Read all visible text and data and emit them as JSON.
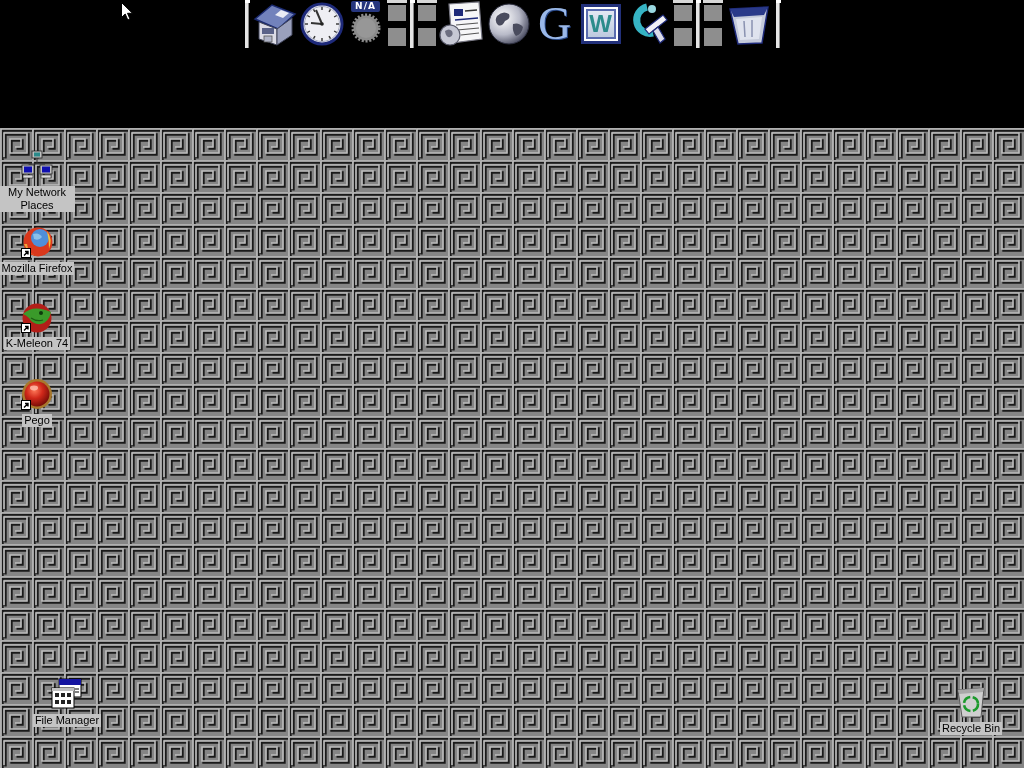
{
  "dock": {
    "items": [
      {
        "kind": "divider"
      },
      {
        "kind": "house"
      },
      {
        "kind": "clock"
      },
      {
        "kind": "weather",
        "label": "N/A"
      },
      {
        "kind": "tiles"
      },
      {
        "kind": "divider"
      },
      {
        "kind": "tiles"
      },
      {
        "kind": "document"
      },
      {
        "kind": "globe"
      },
      {
        "kind": "letter",
        "label": "G"
      },
      {
        "kind": "wordtile",
        "label": "W"
      },
      {
        "kind": "tool"
      },
      {
        "kind": "tiles"
      },
      {
        "kind": "divider"
      },
      {
        "kind": "tiles"
      },
      {
        "kind": "trash"
      },
      {
        "kind": "divider"
      }
    ]
  },
  "desktop": {
    "icons": [
      {
        "kind": "network",
        "label": "My Network Places",
        "shortcut": false
      },
      {
        "kind": "foxglobe",
        "label": "Mozilla Firefox",
        "shortcut": true
      },
      {
        "kind": "chameleon",
        "label": "K-Meleon 74",
        "shortcut": true
      },
      {
        "kind": "ball",
        "label": "Pego",
        "shortcut": true
      },
      {
        "kind": "filewindow",
        "label": "File Manager",
        "shortcut": false
      },
      {
        "kind": "bin",
        "label": "Recycle Bin",
        "shortcut": false
      }
    ]
  }
}
